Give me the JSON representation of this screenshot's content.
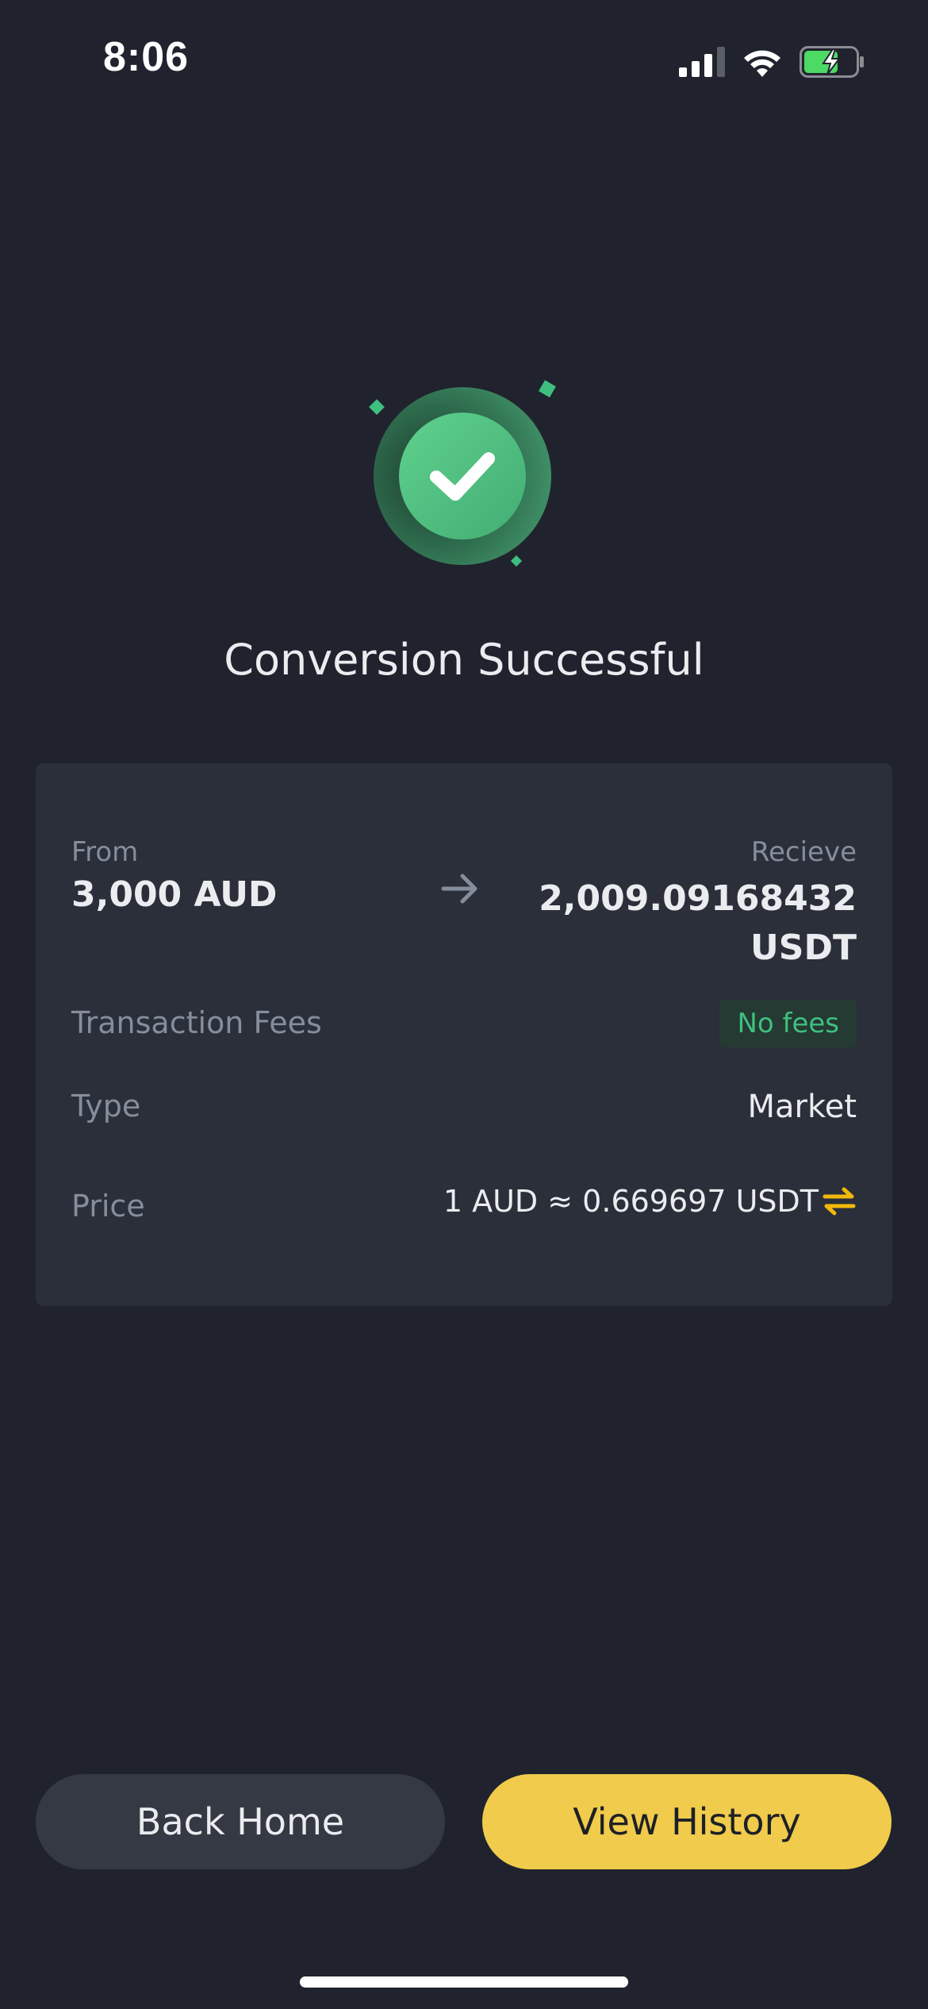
{
  "status_bar": {
    "time": "8:06",
    "icons": [
      "cellular-signal-icon",
      "wifi-icon",
      "battery-charging-icon"
    ]
  },
  "success": {
    "icon": "check-circle-icon",
    "title": "Conversion Successful"
  },
  "summary": {
    "from_label": "From",
    "from_value": "3,000 AUD",
    "arrow_icon": "arrow-right-icon",
    "receive_label": "Recieve",
    "receive_value": "2,009.09168432 USDT",
    "fees_label": "Transaction Fees",
    "fees_value": "No fees",
    "type_label": "Type",
    "type_value": "Market",
    "price_label": "Price",
    "price_value": "1 AUD ≈ 0.669697 USDT",
    "swap_icon": "swap-arrows-icon"
  },
  "actions": {
    "back_home": "Back Home",
    "view_history": "View History"
  },
  "colors": {
    "background": "#20232d",
    "card": "#2b2f3a",
    "accent_yellow": "#f0cb4c",
    "success_green": "#3fbf7f",
    "muted_text": "#848e9c"
  }
}
